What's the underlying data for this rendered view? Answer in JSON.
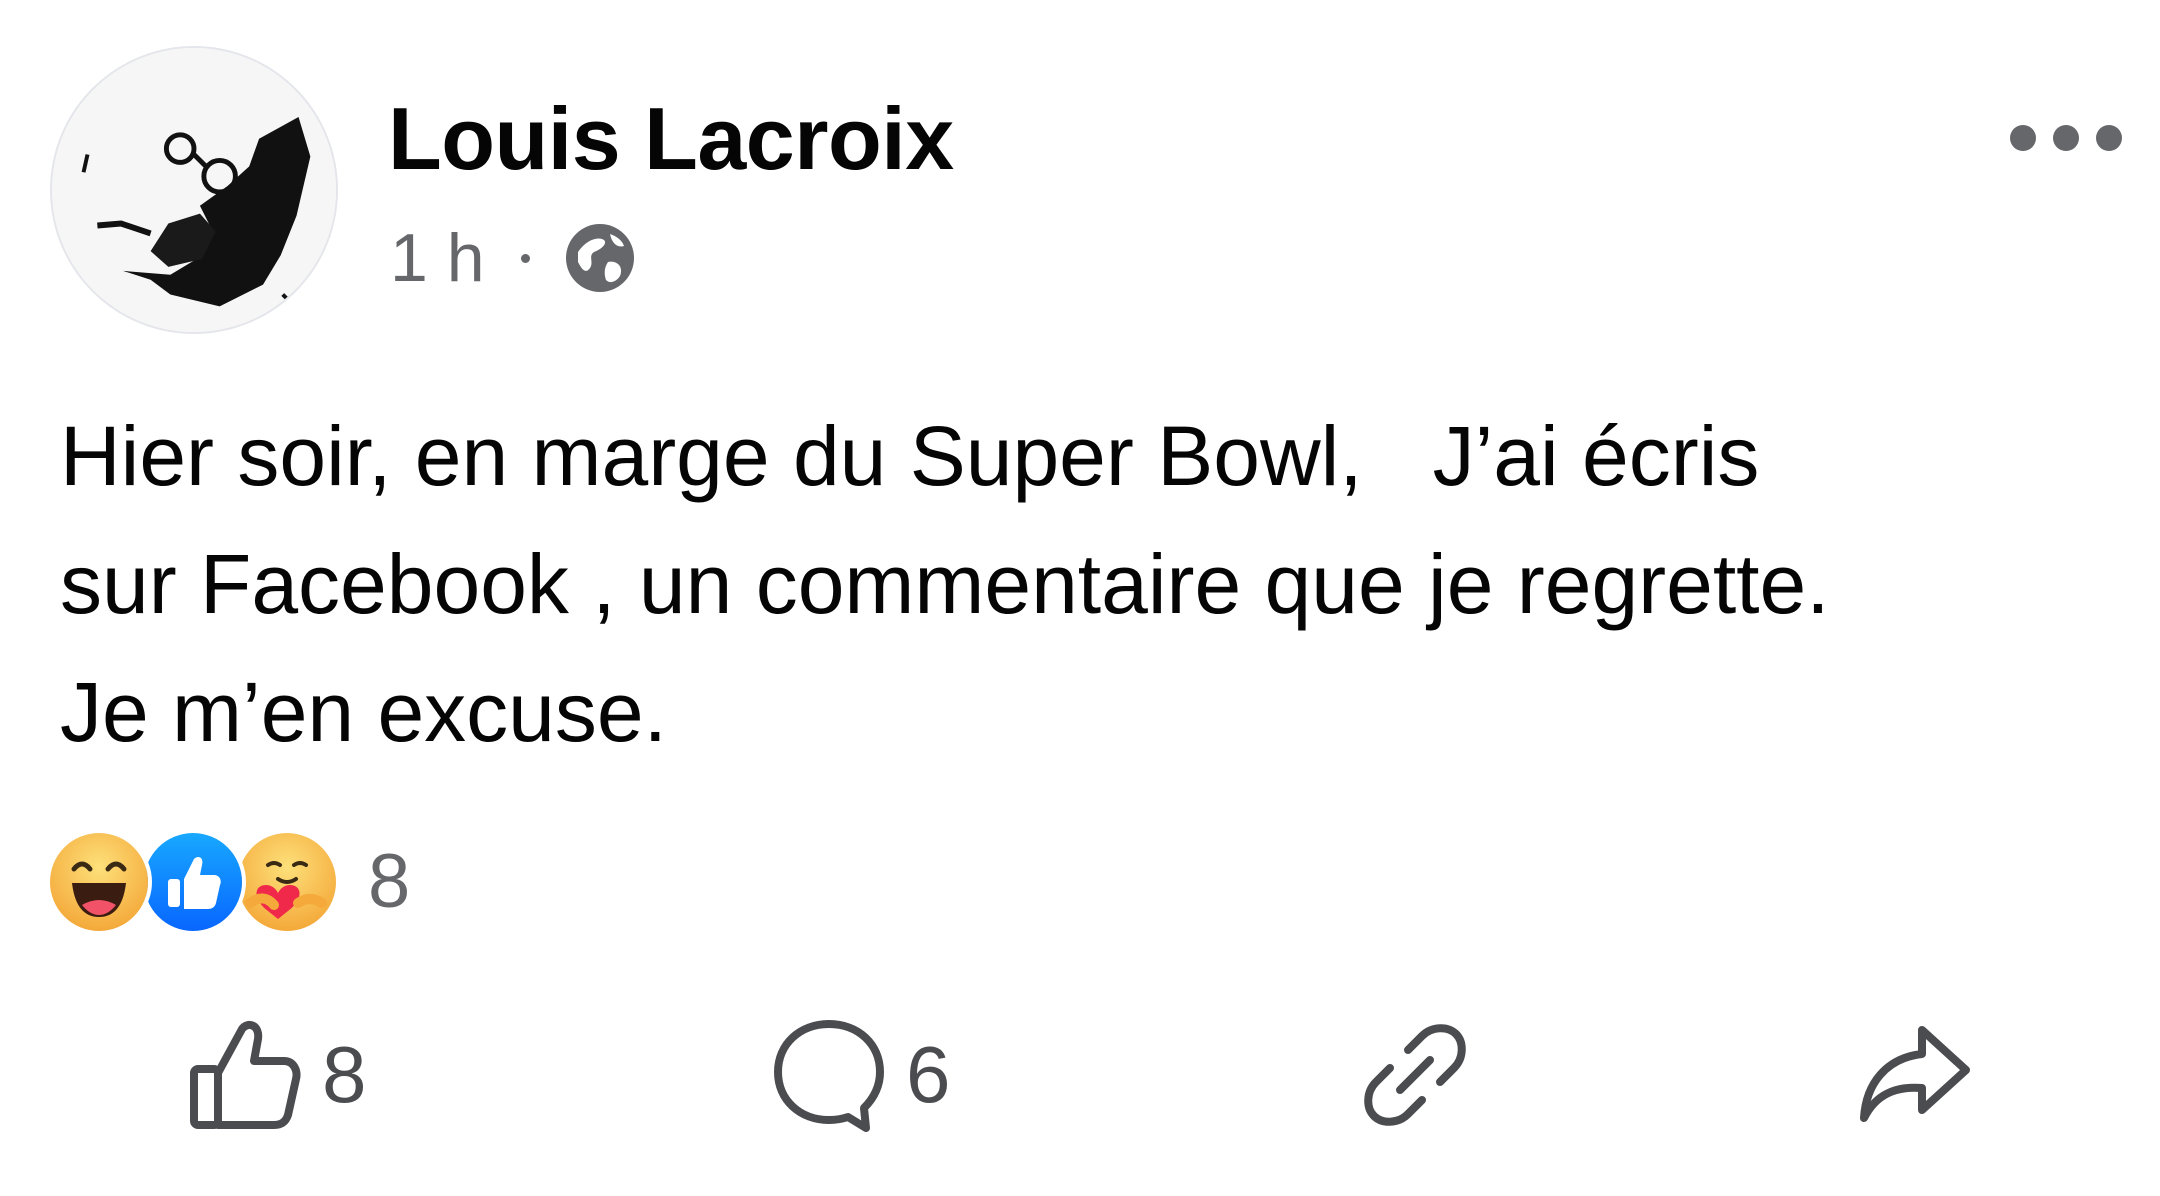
{
  "post": {
    "author": "Louis Lacroix",
    "time": "1 h",
    "audience_icon": "globe-icon",
    "more_icon": "more-options-icon",
    "text": "Hier soir, en marge du Super Bowl,   J’ai écris\nsur Facebook , un commentaire que je regrette.\nJe m’en excuse.",
    "reactions": {
      "icons": [
        "haha-reaction-icon",
        "like-reaction-icon",
        "care-reaction-icon"
      ],
      "count": "8"
    },
    "actions": {
      "like_count": "8",
      "comment_count": "6",
      "link_icon": "link-icon",
      "share_icon": "share-icon"
    }
  },
  "colors": {
    "text_primary": "#050505",
    "text_secondary": "#65676b",
    "like_blue": "#1877f2",
    "haha_yellow": "#fcc94a"
  }
}
